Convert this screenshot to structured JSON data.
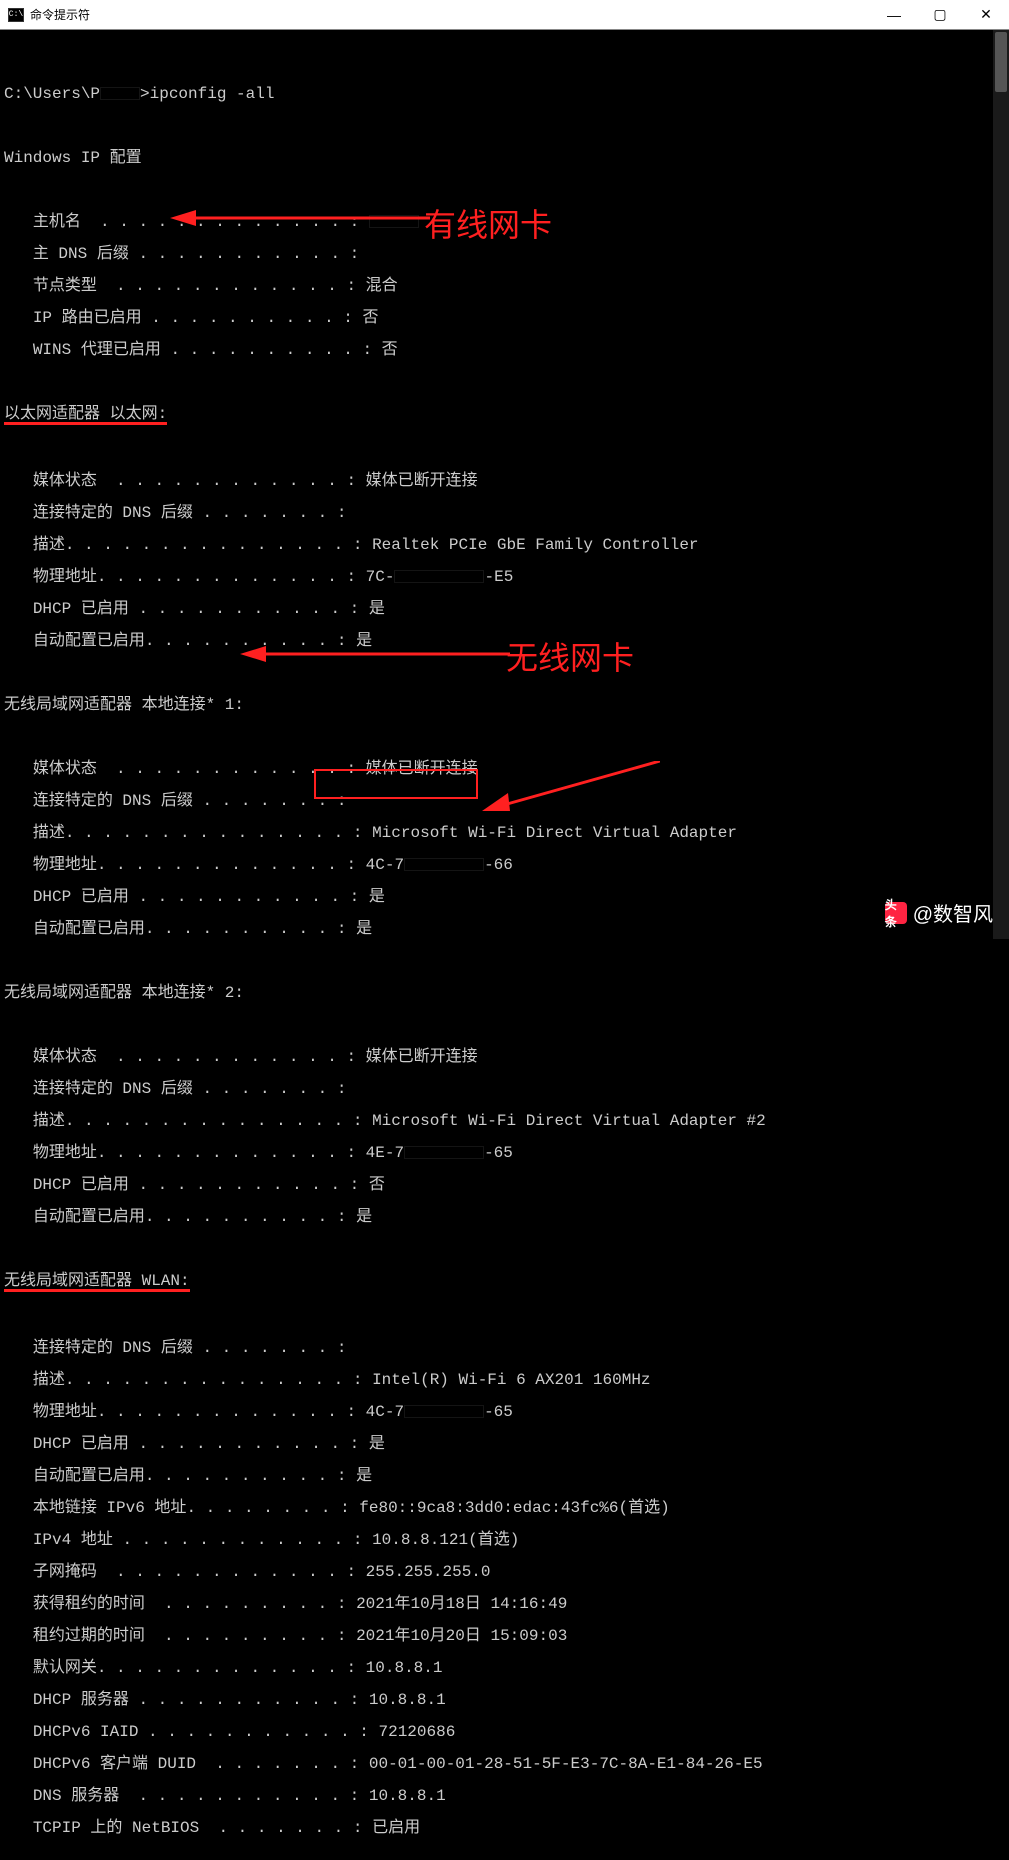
{
  "window": {
    "title": "命令提示符",
    "icon_text": "C:\\"
  },
  "prompt": {
    "path": "C:\\Users\\P",
    "command": "ipconfig -all"
  },
  "header_line": "Windows IP 配置",
  "host_section": {
    "hostname_lbl": "主机名",
    "primary_dns_lbl": "主 DNS 后缀",
    "node_type_lbl": "节点类型",
    "node_type_val": "混合",
    "ip_routing_lbl": "IP 路由已启用",
    "ip_routing_val": "否",
    "wins_proxy_lbl": "WINS 代理已启用",
    "wins_proxy_val": "否"
  },
  "ethernet": {
    "title": "以太网适配器 以太网:",
    "media_state_lbl": "媒体状态",
    "media_state_val": "媒体已断开连接",
    "dns_suffix_lbl": "连接特定的 DNS 后缀",
    "desc_lbl": "描述",
    "desc_val": "Realtek PCIe GbE Family Controller",
    "phys_lbl": "物理地址",
    "phys_prefix": "7C-",
    "phys_suffix": "-E5",
    "dhcp_lbl": "DHCP 已启用",
    "dhcp_val": "是",
    "autoconf_lbl": "自动配置已启用",
    "autoconf_val": "是"
  },
  "annotation_ethernet": "有线网卡",
  "wlan_local1": {
    "title": "无线局域网适配器 本地连接* 1:",
    "media_state_lbl": "媒体状态",
    "media_state_val": "媒体已断开连接",
    "dns_suffix_lbl": "连接特定的 DNS 后缀",
    "desc_lbl": "描述",
    "desc_val": "Microsoft Wi-Fi Direct Virtual Adapter",
    "phys_lbl": "物理地址",
    "phys_prefix": "4C-7",
    "phys_suffix": "-66",
    "dhcp_lbl": "DHCP 已启用",
    "dhcp_val": "是",
    "autoconf_lbl": "自动配置已启用",
    "autoconf_val": "是"
  },
  "wlan_local2": {
    "title": "无线局域网适配器 本地连接* 2:",
    "media_state_lbl": "媒体状态",
    "media_state_val": "媒体已断开连接",
    "dns_suffix_lbl": "连接特定的 DNS 后缀",
    "desc_lbl": "描述",
    "desc_val": "Microsoft Wi-Fi Direct Virtual Adapter #2",
    "phys_lbl": "物理地址",
    "phys_prefix": "4E-7",
    "phys_suffix": "-65",
    "dhcp_lbl": "DHCP 已启用",
    "dhcp_val": "否",
    "autoconf_lbl": "自动配置已启用",
    "autoconf_val": "是"
  },
  "wlan": {
    "title": "无线局域网适配器 WLAN:",
    "dns_suffix_lbl": "连接特定的 DNS 后缀",
    "desc_lbl": "描述",
    "desc_val": "Intel(R) Wi-Fi 6 AX201 160MHz",
    "phys_lbl": "物理地址",
    "phys_prefix": "4C-7",
    "phys_suffix": "-65",
    "dhcp_lbl": "DHCP 已启用",
    "dhcp_val": "是",
    "autoconf_lbl": "自动配置已启用",
    "autoconf_val": "是",
    "link_local_lbl": "本地链接 IPv6 地址",
    "link_local_val": "fe80::9ca8:3dd0:edac:43fc%6(首选)",
    "ipv4_lbl": "IPv4 地址",
    "ipv4_val": "10.8.8.121(首选)",
    "mask_lbl": "子网掩码",
    "mask_val": "255.255.255.0",
    "lease_obtained_lbl": "获得租约的时间",
    "lease_obtained_val": "2021年10月18日 14:16:49",
    "lease_expires_lbl": "租约过期的时间",
    "lease_expires_val": "2021年10月20日 15:09:03",
    "gateway_lbl": "默认网关",
    "gateway_val": "10.8.8.1",
    "dhcp_server_lbl": "DHCP 服务器",
    "dhcp_server_val": "10.8.8.1",
    "dhcpv6_iaid_lbl": "DHCPv6 IAID",
    "dhcpv6_iaid_val": "72120686",
    "dhcpv6_duid_lbl": "DHCPv6 客户端 DUID",
    "dhcpv6_duid_val": "00-01-00-01-28-51-5F-E3-7C-8A-E1-84-26-E5",
    "dns_servers_lbl": "DNS 服务器",
    "dns_servers_val": "10.8.8.1",
    "netbios_lbl": "TCPIP 上的 NetBIOS",
    "netbios_val": "已启用"
  },
  "annotation_wlan": "无线网卡",
  "watermark": {
    "icon_text": "头条",
    "text": "@数智风"
  }
}
